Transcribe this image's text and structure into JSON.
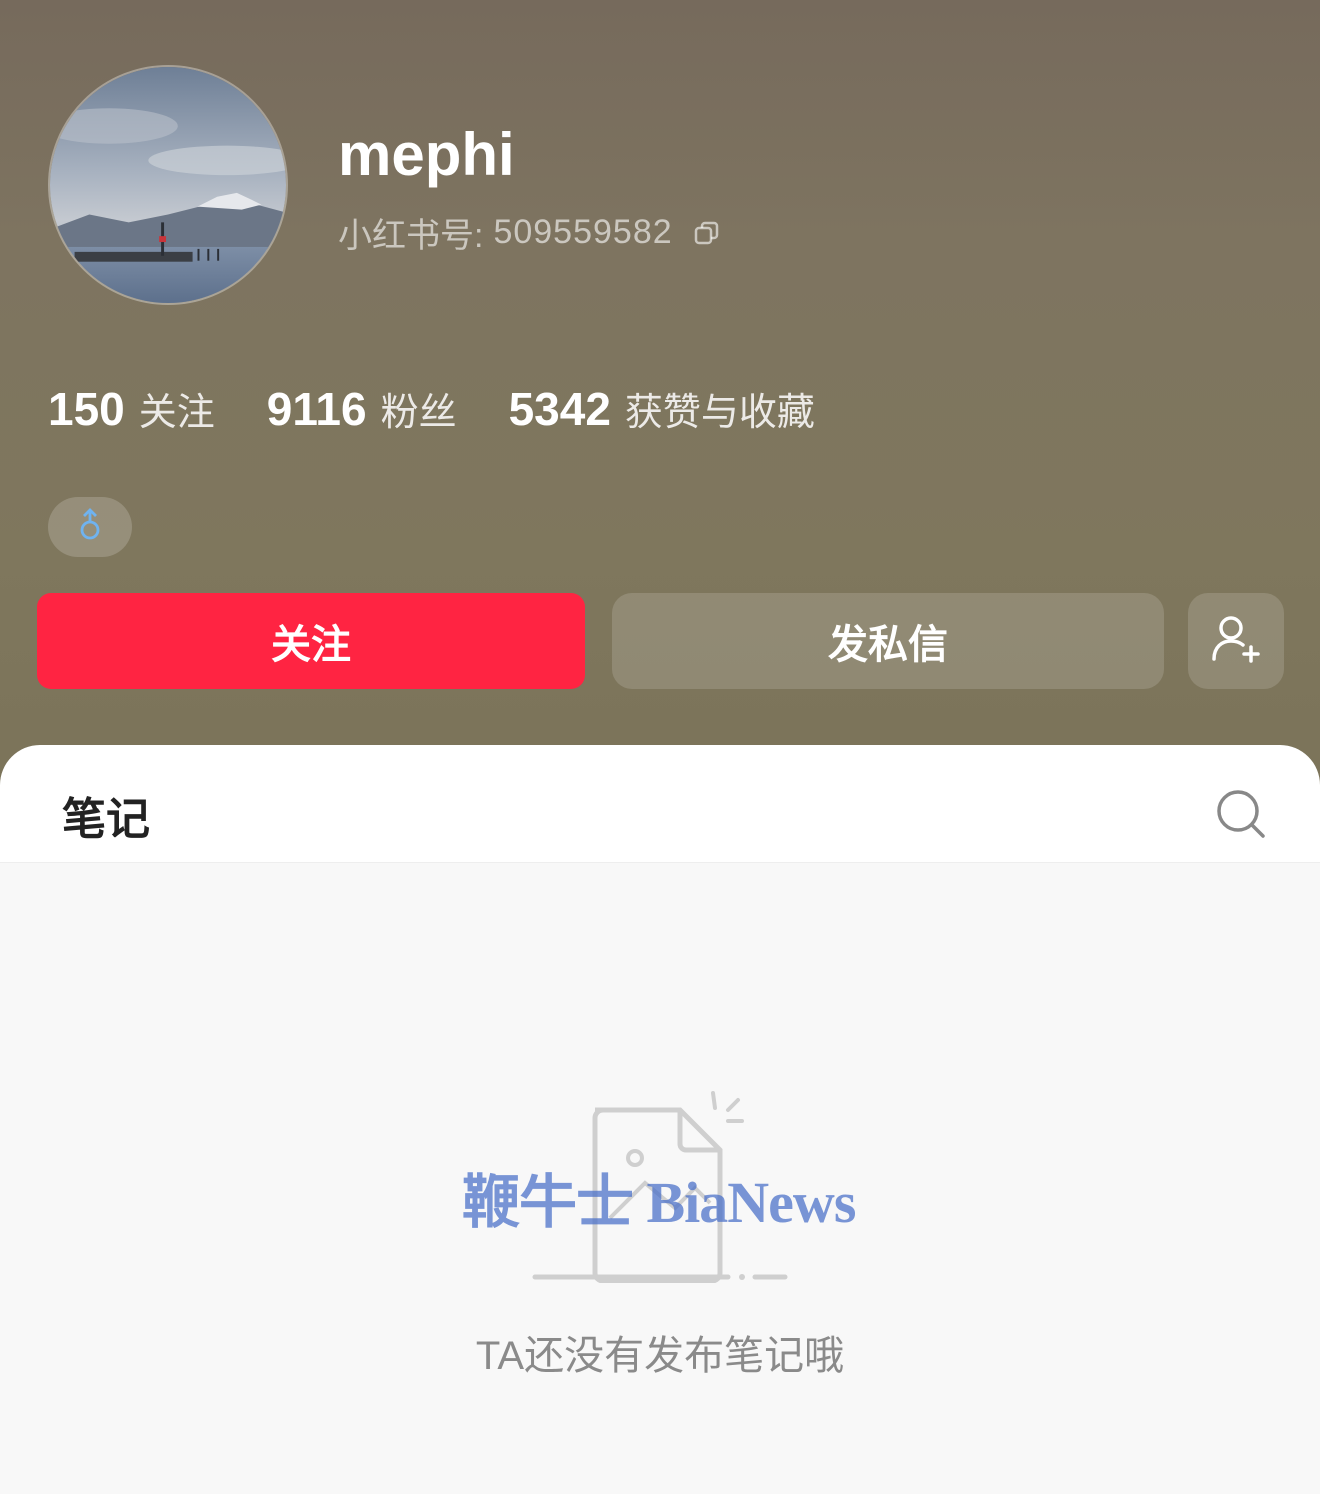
{
  "profile": {
    "username": "mephi",
    "id_label": "小红书号:",
    "id_value": "509559582",
    "copy_icon": "copy-icon",
    "gender_icon": "male-icon"
  },
  "stats": [
    {
      "num": "150",
      "label": "关注"
    },
    {
      "num": "9116",
      "label": "粉丝"
    },
    {
      "num": "5342",
      "label": "获赞与收藏"
    }
  ],
  "actions": {
    "follow_label": "关注",
    "message_label": "发私信",
    "add_friend_icon": "add-user-icon"
  },
  "tabs": {
    "notes_label": "笔记",
    "search_icon": "search-icon"
  },
  "empty_state": {
    "message": "TA还没有发布笔记哦",
    "watermark": "鞭牛士 BiaNews"
  },
  "colors": {
    "follow_button": "#ff2442",
    "header_bg": "#7e7460",
    "gender_male": "#6fb3f0"
  }
}
